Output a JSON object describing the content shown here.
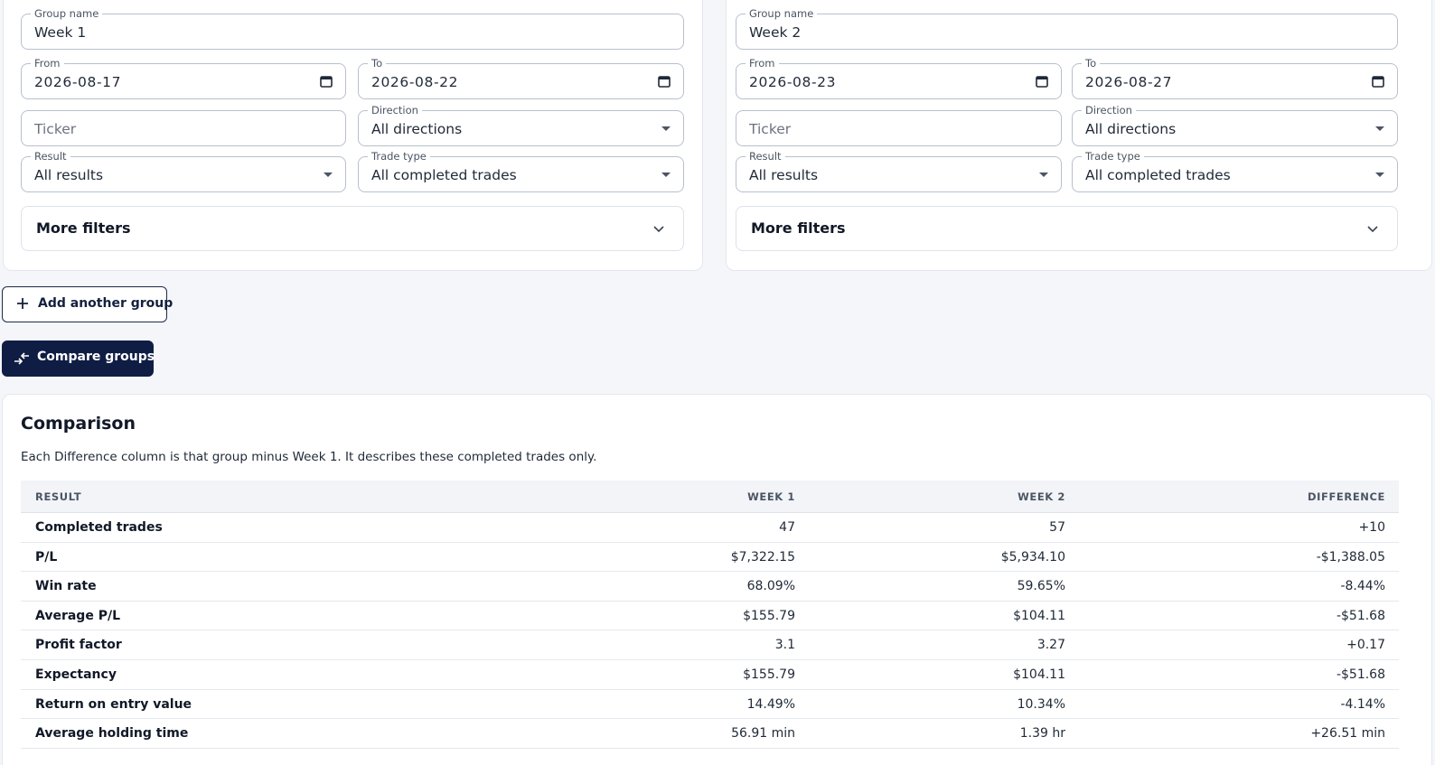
{
  "groups": [
    {
      "name_label": "Group name",
      "name_value": "Week 1",
      "from_label": "From",
      "from_value": "2026-08-17",
      "to_label": "To",
      "to_value": "2026-08-22",
      "ticker_placeholder": "Ticker",
      "direction_label": "Direction",
      "direction_value": "All directions",
      "result_label": "Result",
      "result_value": "All results",
      "trade_type_label": "Trade type",
      "trade_type_value": "All completed trades",
      "more_filters": "More filters"
    },
    {
      "name_label": "Group name",
      "name_value": "Week 2",
      "from_label": "From",
      "from_value": "2026-08-23",
      "to_label": "To",
      "to_value": "2026-08-27",
      "ticker_placeholder": "Ticker",
      "direction_label": "Direction",
      "direction_value": "All directions",
      "result_label": "Result",
      "result_value": "All results",
      "trade_type_label": "Trade type",
      "trade_type_value": "All completed trades",
      "more_filters": "More filters"
    }
  ],
  "actions": {
    "add_group": "Add another group",
    "compare": "Compare groups"
  },
  "comparison": {
    "title": "Comparison",
    "description": "Each Difference column is that group minus Week 1. It describes these completed trades only.",
    "headers": [
      "RESULT",
      "WEEK 1",
      "WEEK 2",
      "DIFFERENCE"
    ],
    "rows": [
      {
        "metric": "Completed trades",
        "week1": "47",
        "week2": "57",
        "diff": "+10"
      },
      {
        "metric": "P/L",
        "week1": "$7,322.15",
        "week2": "$5,934.10",
        "diff": "-$1,388.05"
      },
      {
        "metric": "Win rate",
        "week1": "68.09%",
        "week2": "59.65%",
        "diff": "-8.44%"
      },
      {
        "metric": "Average P/L",
        "week1": "$155.79",
        "week2": "$104.11",
        "diff": "-$51.68"
      },
      {
        "metric": "Profit factor",
        "week1": "3.1",
        "week2": "3.27",
        "diff": "+0.17"
      },
      {
        "metric": "Expectancy",
        "week1": "$155.79",
        "week2": "$104.11",
        "diff": "-$51.68"
      },
      {
        "metric": "Return on entry value",
        "week1": "14.49%",
        "week2": "10.34%",
        "diff": "-4.14%"
      },
      {
        "metric": "Average holding time",
        "week1": "56.91 min",
        "week2": "1.39 hr",
        "diff": "+26.51 min"
      }
    ]
  },
  "icons": {
    "date": "calendar-icon",
    "select": "caret-down-icon",
    "expand": "chevron-down-icon",
    "add": "plus-icon",
    "compare": "compare-arrows-icon"
  },
  "colors": {
    "primary": "#0f1d45",
    "background": "#f4f6f9",
    "border": "#b9c0cb"
  }
}
